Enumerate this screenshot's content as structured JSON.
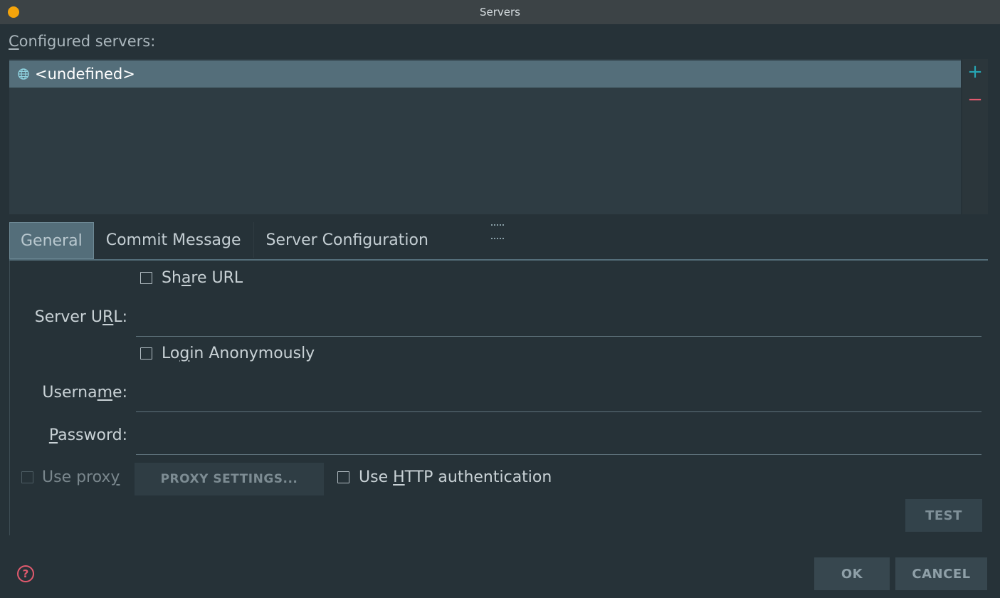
{
  "window": {
    "title": "Servers"
  },
  "servers": {
    "label_mnemonic": "C",
    "label_rest": "onfigured servers:",
    "items": [
      {
        "name": "<undefined>",
        "icon": "globe-icon"
      }
    ],
    "add_symbol": "+",
    "remove_symbol": "−"
  },
  "tabs": [
    {
      "label": "General",
      "active": true
    },
    {
      "label": "Commit Message",
      "active": false
    },
    {
      "label": "Server Configuration",
      "active": false
    }
  ],
  "general": {
    "share_url": {
      "pre": "Sh",
      "mn": "a",
      "post": "re URL",
      "checked": false
    },
    "server_url": {
      "pre": "Server U",
      "mn": "R",
      "post": "L:",
      "value": ""
    },
    "login_anon": {
      "pre": "Lo",
      "mn": "g",
      "post": "in Anonymously",
      "checked": false
    },
    "username": {
      "pre": "Userna",
      "mn": "m",
      "post": "e:",
      "value": ""
    },
    "password": {
      "pre": "",
      "mn": "P",
      "post": "assword:",
      "value": ""
    },
    "use_proxy": {
      "pre": "Use prox",
      "mn": "y",
      "post": "",
      "checked": false,
      "enabled": false
    },
    "proxy_settings_button": "PROXY SETTINGS...",
    "http_auth": {
      "pre": "Use ",
      "mn": "H",
      "post": "TTP authentication",
      "checked": false
    },
    "test_button": "TEST"
  },
  "footer": {
    "help_symbol": "?",
    "ok_button": "OK",
    "cancel_button": "CANCEL"
  },
  "colors": {
    "background": "#263238",
    "titlebar": "#3c4346",
    "selection": "#546e7a",
    "accent_add": "#26a6b4",
    "accent_remove": "#e25a6e",
    "traffic_light": "#f4a40b"
  }
}
